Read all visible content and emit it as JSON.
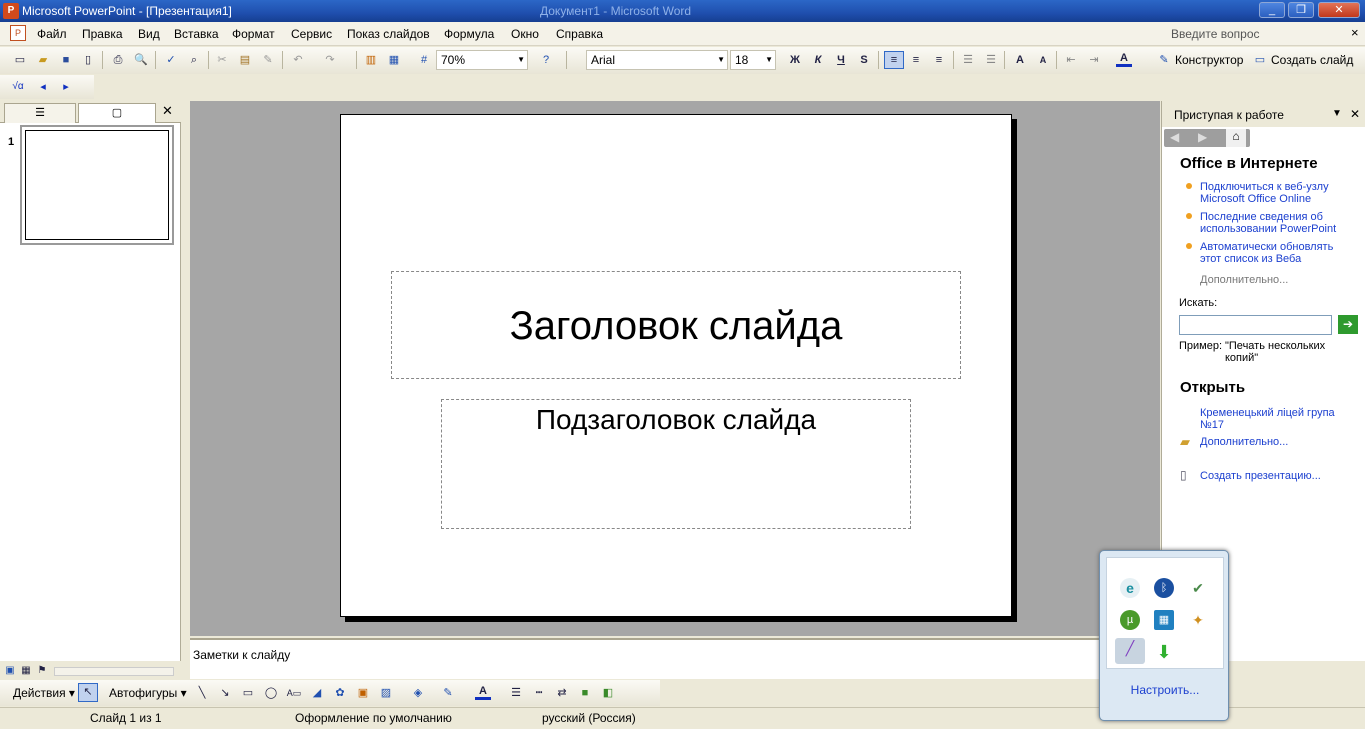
{
  "window": {
    "title": "Microsoft PowerPoint - [Презентация1]",
    "ghost_title": "Документ1 - Microsoft Word",
    "app_icon_letter": "P",
    "buttons": {
      "minimize": "_",
      "restore": "❐",
      "close": "✕"
    }
  },
  "menu": {
    "items": [
      "Файл",
      "Правка",
      "Вид",
      "Вставка",
      "Формат",
      "Сервис",
      "Показ слайдов",
      "Формула",
      "Окно",
      "Справка"
    ],
    "ask_placeholder": "Введите вопрос",
    "close_glyph": "×"
  },
  "toolbar": {
    "zoom": "70%",
    "font": "Arial",
    "font_size": "18",
    "bold": "Ж",
    "italic": "К",
    "underline": "Ч",
    "shadow": "S",
    "designer_label": "Конструктор",
    "new_slide_label": "Создать слайд"
  },
  "left_panel": {
    "slide_number": "1"
  },
  "slide": {
    "title": "Заголовок слайда",
    "subtitle": "Подзаголовок слайда"
  },
  "notes": {
    "placeholder": "Заметки к слайду"
  },
  "drawing_toolbar": {
    "actions_label": "Действия",
    "autoshapes_label": "Автофигуры"
  },
  "status": {
    "slide": "Слайд 1 из 1",
    "design": "Оформление по умолчанию",
    "language": "русский (Россия)"
  },
  "task_pane": {
    "title": "Приступая к работе",
    "office_online": {
      "heading": "Office в Интернете",
      "links": [
        "Подключиться к веб-узлу Microsoft Office Online",
        "Последние сведения об использовании PowerPoint",
        "Автоматически обновлять этот список из Веба"
      ],
      "more": "Дополнительно..."
    },
    "search": {
      "label": "Искать:",
      "value": "",
      "example_label": "Пример:",
      "example_text": "\"Печать нескольких копий\""
    },
    "open": {
      "heading": "Открыть",
      "recent": "Кременецький ліцей група №17",
      "more": "Дополнительно...",
      "create": "Создать презентацию..."
    }
  },
  "tray_popup": {
    "customize": "Настроить..."
  }
}
